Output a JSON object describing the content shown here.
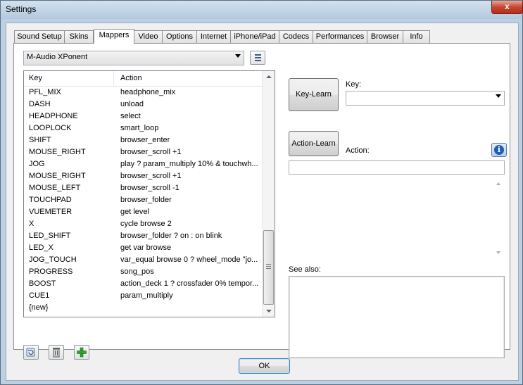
{
  "window": {
    "title": "Settings",
    "close_label": "x"
  },
  "tabs": [
    {
      "label": "Sound Setup"
    },
    {
      "label": "Skins"
    },
    {
      "label": "Mappers"
    },
    {
      "label": "Video"
    },
    {
      "label": "Options"
    },
    {
      "label": "Internet"
    },
    {
      "label": "iPhone/iPad"
    },
    {
      "label": "Codecs"
    },
    {
      "label": "Performances"
    },
    {
      "label": "Browser"
    },
    {
      "label": "Info"
    }
  ],
  "active_tab": "Mappers",
  "device_select": {
    "value": "M-Audio XPonent"
  },
  "mapping_list": {
    "columns": {
      "key": "Key",
      "action": "Action"
    },
    "rows": [
      {
        "key": "PFL_MIX",
        "action": "headphone_mix"
      },
      {
        "key": "DASH",
        "action": "unload"
      },
      {
        "key": "HEADPHONE",
        "action": "select"
      },
      {
        "key": "LOOPLOCK",
        "action": "smart_loop"
      },
      {
        "key": "SHIFT",
        "action": "browser_enter"
      },
      {
        "key": "MOUSE_RIGHT",
        "action": "browser_scroll +1"
      },
      {
        "key": "JOG",
        "action": "play ? param_multiply 10% & touchwh..."
      },
      {
        "key": "MOUSE_RIGHT",
        "action": "browser_scroll +1"
      },
      {
        "key": "MOUSE_LEFT",
        "action": "browser_scroll -1"
      },
      {
        "key": "TOUCHPAD",
        "action": "browser_folder"
      },
      {
        "key": "VUEMETER",
        "action": "get level"
      },
      {
        "key": "X",
        "action": "cycle browse 2"
      },
      {
        "key": "LED_SHIFT",
        "action": "browser_folder ? on : on blink"
      },
      {
        "key": "LED_X",
        "action": "get var browse"
      },
      {
        "key": "JOG_TOUCH",
        "action": "var_equal browse 0 ? wheel_mode \"jo..."
      },
      {
        "key": "PROGRESS",
        "action": "song_pos"
      },
      {
        "key": "BOOST",
        "action": "action_deck 1 ? crossfader 0% tempor..."
      },
      {
        "key": "CUE1",
        "action": "param_multiply"
      },
      {
        "key": "{new}",
        "action": ""
      }
    ]
  },
  "right_panel": {
    "key_learn_label": "Key-Learn",
    "key_label": "Key:",
    "key_value": "",
    "action_learn_label": "Action-Learn",
    "action_label": "Action:",
    "action_value": "",
    "info_label": "i",
    "see_also_label": "See also:",
    "see_also_value": ""
  },
  "ok_label": "OK",
  "icons": {
    "list": "list-view-icon",
    "restore": "reset-icon",
    "delete": "trash-icon",
    "add": "plus-icon"
  }
}
